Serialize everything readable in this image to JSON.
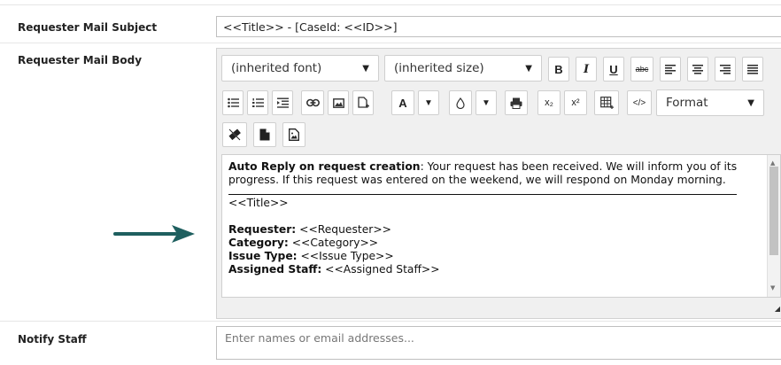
{
  "fields": {
    "subject_label": "Requester Mail Subject",
    "subject_value": "<<Title>> - [CaseId: <<ID>>]",
    "body_label": "Requester Mail Body",
    "notify_label": "Notify Staff",
    "notify_placeholder": "Enter names or email addresses..."
  },
  "toolbar": {
    "font_family": "(inherited font)",
    "font_size": "(inherited size)",
    "bold": "B",
    "italic": "I",
    "underline": "U",
    "strike": "abc",
    "text_color": "A",
    "subscript": "x₂",
    "superscript": "x²",
    "source": "</>",
    "format": "Format"
  },
  "body": {
    "intro_bold": "Auto Reply on request creation",
    "intro_text": ": Your request has been received. We will inform you of its progress. If this request was entered on the weekend, we will respond on Monday morning.",
    "title_token": "<<Title>>",
    "lines": [
      {
        "label": "Requester:",
        "value": " <<Requester>>"
      },
      {
        "label": "Category:",
        "value": " <<Category>>"
      },
      {
        "label": "Issue Type:",
        "value": " <<Issue Type>>"
      },
      {
        "label": "Assigned Staff:",
        "value": " <<Assigned Staff>>"
      }
    ]
  },
  "colors": {
    "arrow": "#1e5f5f"
  }
}
